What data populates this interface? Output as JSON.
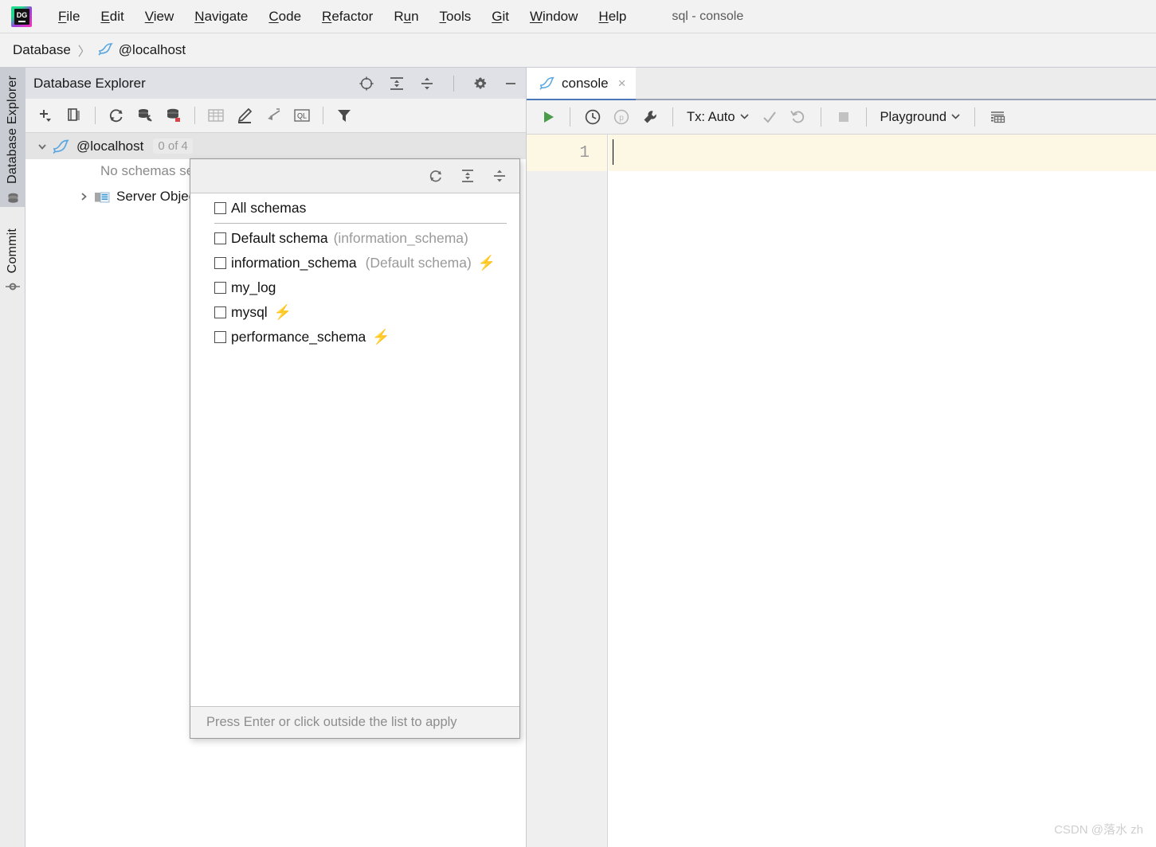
{
  "window": {
    "title": "sql - console",
    "app_icon": "datagrip-logo-icon"
  },
  "menubar": {
    "items": [
      {
        "label": "File",
        "mnemonic": "F"
      },
      {
        "label": "Edit",
        "mnemonic": "E"
      },
      {
        "label": "View",
        "mnemonic": "V"
      },
      {
        "label": "Navigate",
        "mnemonic": "N"
      },
      {
        "label": "Code",
        "mnemonic": "C"
      },
      {
        "label": "Refactor",
        "mnemonic": "R"
      },
      {
        "label": "Run",
        "mnemonic": "u"
      },
      {
        "label": "Tools",
        "mnemonic": "T"
      },
      {
        "label": "Git",
        "mnemonic": "G"
      },
      {
        "label": "Window",
        "mnemonic": "W"
      },
      {
        "label": "Help",
        "mnemonic": "H"
      }
    ]
  },
  "breadcrumb": {
    "root": "Database",
    "separator": "〉",
    "node": "@localhost"
  },
  "tool_stripe": {
    "tabs": [
      {
        "label": "Database Explorer",
        "icon": "database-icon",
        "active": true
      },
      {
        "label": "Commit",
        "icon": "commit-icon",
        "active": false
      }
    ]
  },
  "database_explorer": {
    "title": "Database Explorer",
    "header_actions": [
      {
        "name": "select-opened-file",
        "icon": "crosshair-icon"
      },
      {
        "name": "expand-all",
        "icon": "expand-all-icon"
      },
      {
        "name": "collapse-all",
        "icon": "collapse-all-icon"
      },
      {
        "name": "options",
        "icon": "gear-icon"
      },
      {
        "name": "hide",
        "icon": "minimize-icon"
      }
    ],
    "toolbar_actions": [
      {
        "name": "new",
        "icon": "plus-dropdown-icon"
      },
      {
        "name": "duplicate",
        "icon": "copy-icon"
      },
      {
        "name": "refresh",
        "icon": "refresh-icon"
      },
      {
        "name": "modify-object",
        "icon": "db-wrench-icon"
      },
      {
        "name": "db-color-settings",
        "icon": "db-red-icon"
      },
      {
        "name": "open-data-editor",
        "icon": "table-grid-icon",
        "disabled": true
      },
      {
        "name": "edit-source",
        "icon": "pencil-icon"
      },
      {
        "name": "jump-to-source",
        "icon": "jump-arrow-icon"
      },
      {
        "name": "open-ql-console",
        "icon": "ql-console-icon"
      },
      {
        "name": "filter",
        "icon": "funnel-icon"
      }
    ],
    "tree": {
      "root": {
        "label": "@localhost",
        "icon": "mysql-dolphin-icon",
        "badge": "0 of 4",
        "expanded": true,
        "selected": true
      },
      "children": [
        {
          "label": "No schemas selected",
          "type": "hint"
        },
        {
          "label": "Server Objects",
          "type": "folder",
          "icon": "server-objects-icon",
          "expanded": false
        }
      ]
    }
  },
  "schema_popup": {
    "header_actions": [
      {
        "name": "refresh",
        "icon": "refresh-icon"
      },
      {
        "name": "expand-all",
        "icon": "expand-all-icon"
      },
      {
        "name": "collapse-all",
        "icon": "collapse-all-icon"
      }
    ],
    "options": [
      {
        "label": "All schemas",
        "suffix": "",
        "checked": false,
        "bolt": false,
        "divider_after": true
      },
      {
        "label": "Default schema",
        "suffix": "(information_schema)",
        "checked": false,
        "bolt": false
      },
      {
        "label": "information_schema",
        "suffix": "(Default schema)",
        "checked": false,
        "bolt": true
      },
      {
        "label": "my_log",
        "suffix": "",
        "checked": false,
        "bolt": false
      },
      {
        "label": "mysql",
        "suffix": "",
        "checked": false,
        "bolt": true
      },
      {
        "label": "performance_schema",
        "suffix": "",
        "checked": false,
        "bolt": true
      }
    ],
    "footer_hint": "Press Enter or click outside the list to apply"
  },
  "console": {
    "tab": {
      "label": "console",
      "icon": "mysql-dolphin-icon",
      "close": "×"
    },
    "toolbar": {
      "run_label": "",
      "tx_label": "Tx: Auto",
      "schema_label": "Playground",
      "buttons": [
        {
          "name": "execute",
          "icon": "run-triangle-icon"
        },
        {
          "name": "execution-history",
          "icon": "clock-icon"
        },
        {
          "name": "parameters",
          "icon": "p-circle-icon",
          "disabled": true
        },
        {
          "name": "settings",
          "icon": "wrench-icon"
        },
        {
          "name": "commit",
          "icon": "check-icon",
          "disabled": true
        },
        {
          "name": "rollback",
          "icon": "rollback-icon",
          "disabled": true
        },
        {
          "name": "stop",
          "icon": "stop-square-icon",
          "disabled": true
        },
        {
          "name": "output-options",
          "icon": "grid-output-icon"
        }
      ]
    },
    "editor": {
      "line_numbers": [
        "1"
      ],
      "lines": [
        ""
      ]
    }
  },
  "watermark": "CSDN @落水 zh",
  "colors": {
    "accent": "#4a78b8",
    "bolt": "#f5a623",
    "panel_header": "#dfe1e6",
    "toolbar_bg": "#f2f2f2",
    "caret_line": "#fdf8e3",
    "run_green": "#4a9c4a"
  }
}
